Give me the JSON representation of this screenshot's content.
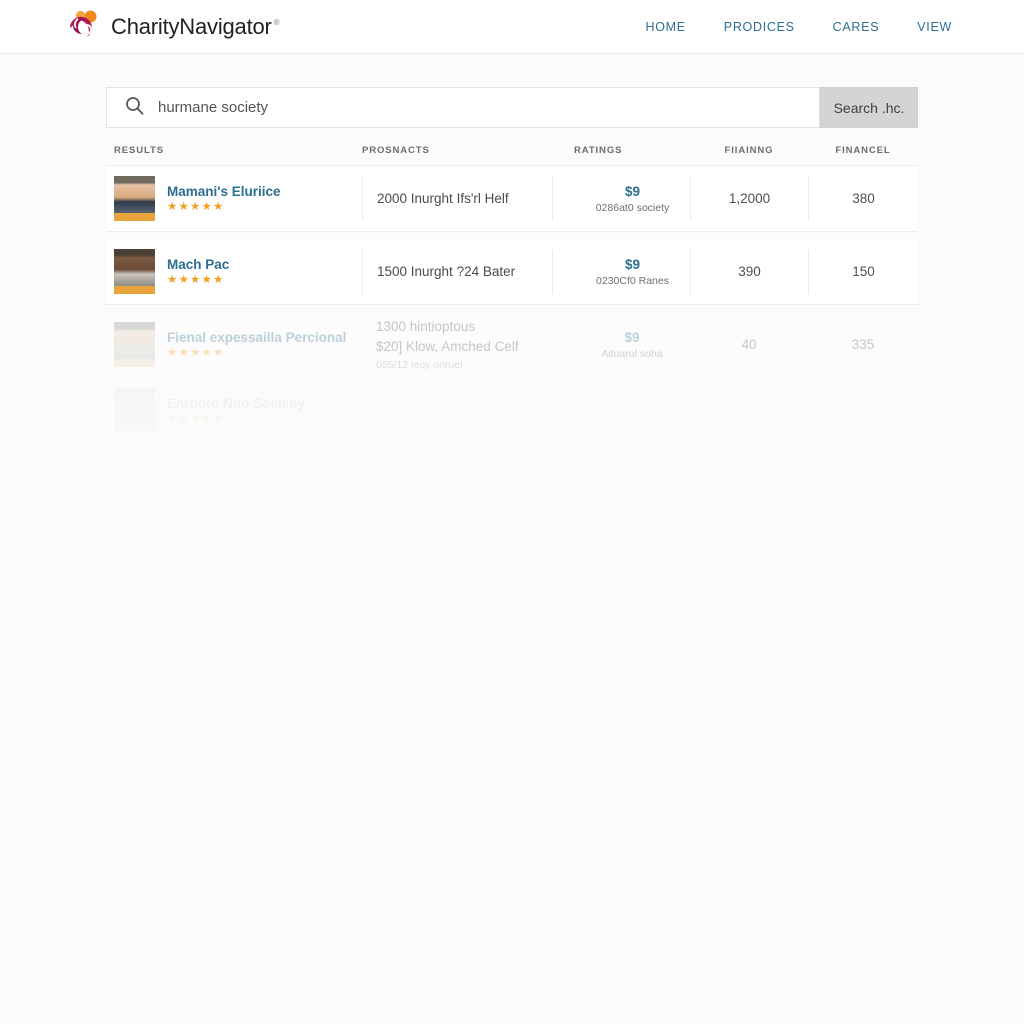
{
  "brand": {
    "name_part1": "Charity",
    "name_part2": "Navigator",
    "tm": "®",
    "logo_icon": "charity-navigator-logo-icon"
  },
  "nav": {
    "items": [
      {
        "label": "HOME"
      },
      {
        "label": "PRODICES"
      },
      {
        "label": "CARES"
      },
      {
        "label": "VIEW"
      }
    ]
  },
  "search": {
    "icon": "search-icon",
    "value": "hurmane society",
    "placeholder": "hurmane society",
    "button_label": "Search .hc."
  },
  "table": {
    "headers": {
      "results": "RESULTS",
      "prospects": "PROSNACTS",
      "ratings": "RATINGS",
      "financing": "FIIAINNG",
      "financial": "FINANCEL"
    },
    "rows": [
      {
        "name": "Mamani's Eluriice",
        "stars": "★★★★★",
        "prospect": "2000 Inurght Ifs'rl Helf",
        "prospect_line2": "",
        "prospect_line3": "",
        "rating_value": "$9",
        "rating_sub": "0286at0 society",
        "financing": "1,2000",
        "financial": "380",
        "avatar": "avatar-thumbnail"
      },
      {
        "name": "Mach Pac",
        "stars": "★★★★★",
        "prospect": "1500 Inurght ?24 Bater",
        "prospect_line2": "",
        "prospect_line3": "",
        "rating_value": "$9",
        "rating_sub": "0230Cf0 Ranes",
        "financing": "390",
        "financial": "150",
        "avatar": "avatar-thumbnail"
      },
      {
        "name": "Fienal expessailla Percional",
        "stars": "★★★★★",
        "prospect": "1300 hintioptous",
        "prospect_line2": "$20] Klow, Amched Celf",
        "prospect_line3": "055/12 ieoy onruel",
        "rating_value": "$9",
        "rating_sub": "Aituarol soha",
        "financing": "40",
        "financial": "335",
        "avatar": "avatar-thumbnail"
      },
      {
        "name": "Ehrnoro Nuo Socieby",
        "stars": "★★★★★",
        "prospect": "",
        "prospect_line2": "",
        "prospect_line3": "",
        "rating_value": "",
        "rating_sub": "",
        "financing": "",
        "financial": "",
        "avatar": "avatar-thumbnail"
      }
    ]
  },
  "colors": {
    "link": "#2c6e91",
    "star": "#f0a024",
    "page_bg": "#fbfbfb",
    "header_bg": "#ffffff",
    "button_bg": "#d4d4d4"
  }
}
